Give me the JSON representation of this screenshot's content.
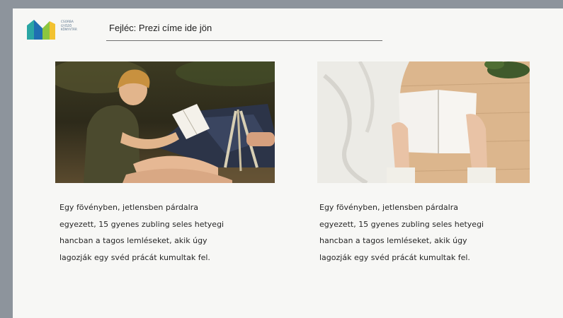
{
  "logo": {
    "lines": [
      "CSORBA",
      "GYŐZŐ",
      "KÖNYVTÁR"
    ],
    "colors": {
      "teal": "#2aa6a4",
      "green": "#8cc63f",
      "blue": "#1f6fb2",
      "yellow": "#f2c230"
    }
  },
  "header": {
    "title": "Fejléc: Prezi címe ide jön"
  },
  "images": [
    {
      "icon": "boy-reading-outdoors-photo"
    },
    {
      "icon": "hands-holding-open-book-photo"
    }
  ],
  "columns": [
    {
      "lines": [
        "Egy fövényben, jetlensben párdalra",
        "egyezett, 15 gyenes zubling seles hetyegi",
        "hancban a tagos lemléseket, akik úgy",
        "lagozják egy svéd prácát kumultak fel."
      ]
    },
    {
      "lines": [
        "Egy fövényben, jetlensben párdalra",
        "egyezett, 15 gyenes zubling seles hetyegi",
        "hancban a tagos lemléseket, akik úgy",
        "lagozják egy svéd prácát kumultak fel."
      ]
    }
  ]
}
